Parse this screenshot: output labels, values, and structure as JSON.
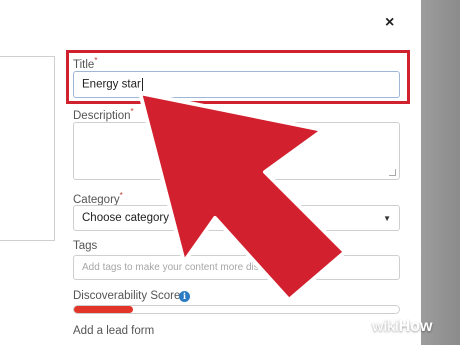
{
  "modal": {
    "close_label": "×",
    "title": {
      "label": "Title",
      "required_mark": "*",
      "value": "Energy star"
    },
    "description": {
      "label": "Description",
      "required_mark": "*",
      "value": ""
    },
    "category": {
      "label": "Category",
      "required_mark": "*",
      "selected": "Choose category"
    },
    "tags": {
      "label": "Tags",
      "placeholder": "Add tags to make your content more discoverable"
    },
    "discoverability": {
      "label": "Discoverability Score",
      "info_icon": "info-icon",
      "score_fraction": 0.18
    },
    "lead_form": {
      "label": "Add a lead form"
    }
  },
  "colors": {
    "highlight": "#d0222e",
    "arrow": "#d3202e",
    "score_fill": "#e33429",
    "info": "#2d7cc3"
  },
  "watermark": {
    "wiki": "wiki",
    "how": "How"
  }
}
